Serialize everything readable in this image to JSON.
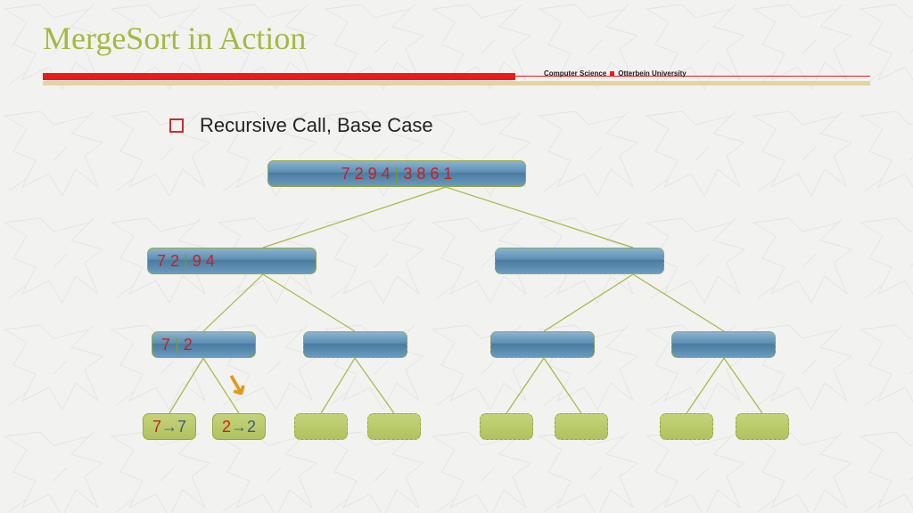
{
  "title": "MergeSort in Action",
  "institution_left": "Computer Science",
  "institution_right": "Otterbein University",
  "bullet": "Recursive Call, Base Case",
  "nodes": {
    "root_left": "7 2 9 4",
    "root_sep": " | ",
    "root_right": "3 8 6 1",
    "l1_left": "7 2",
    "l1_sep": " | ",
    "l1_right": "9 4",
    "l2_left": "7",
    "l2_sep": " | ",
    "l2_right": "2",
    "leaf1_in": "7",
    "leaf1_arrow": "→",
    "leaf1_out": "7",
    "leaf2_in": "2",
    "leaf2_arrow": "→",
    "leaf2_out": "2"
  }
}
